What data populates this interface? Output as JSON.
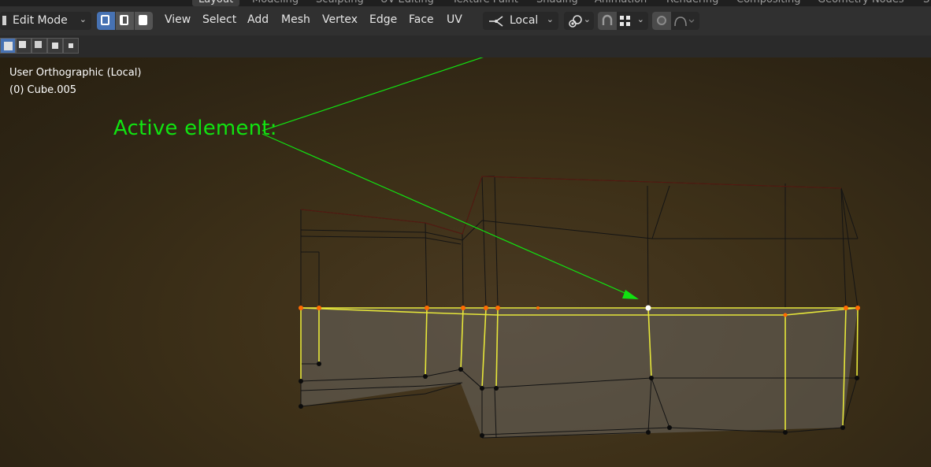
{
  "workspace_tabs": [
    "Layout",
    "Modeling",
    "Sculpting",
    "UV Editing",
    "Texture Paint",
    "Shading",
    "Animation",
    "Rendering",
    "Compositing",
    "Geometry Nodes",
    "S"
  ],
  "header": {
    "mode": "Edit Mode",
    "menus": [
      "View",
      "Select",
      "Add",
      "Mesh",
      "Vertex",
      "Edge",
      "Face",
      "UV"
    ],
    "orientation": "Local"
  },
  "viewport": {
    "view_name": "User Orthographic (Local)",
    "object_info": "(0) Cube.005",
    "annotation": "Active element:",
    "annotation_color": "#11e311"
  },
  "colors": {
    "selected_edge": "#e6e63a",
    "selected_vertex": "#ff6a00",
    "active_vertex": "#ffffff",
    "wire": "#141414",
    "selection_mode_active": "#4772b3"
  }
}
